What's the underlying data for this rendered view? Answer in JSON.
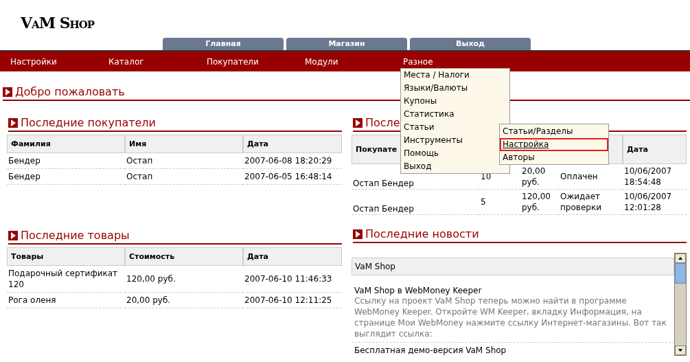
{
  "logo": "VaM Shop",
  "tabs": [
    "Главная",
    "Магазин",
    "Выход"
  ],
  "nav": [
    "Настройки",
    "Каталог",
    "Покупатели",
    "Модули",
    "Разное"
  ],
  "dropdown": {
    "items": [
      {
        "label": "Места / Налоги"
      },
      {
        "label": "Языки/Валюты"
      },
      {
        "label": "Купоны"
      },
      {
        "label": "Статистика"
      },
      {
        "label": "Статьи",
        "children": [
          {
            "label": "Статьи/Разделы",
            "selected": false
          },
          {
            "label": "Настройка",
            "selected": true
          },
          {
            "label": "Авторы",
            "selected": false
          }
        ]
      },
      {
        "label": "Инструменты"
      },
      {
        "label": "Помощь"
      },
      {
        "label": "Выход"
      }
    ]
  },
  "welcome": "Добро пожаловать",
  "customers": {
    "title": "Последние покупатели",
    "columns": [
      "Фамилия",
      "Имя",
      "Дата"
    ],
    "rows": [
      [
        "Бендер",
        "Остап",
        "2007-06-08 18:20:29"
      ],
      [
        "Бендер",
        "Остап",
        "2007-06-05 16:48:14"
      ]
    ]
  },
  "orders": {
    "title": "После",
    "columns": [
      "Покупате",
      null,
      null,
      null,
      "Дата"
    ],
    "rows": [
      [
        "Остап Бендер",
        "10",
        "20,00 руб.",
        "Оплачен",
        "10/06/2007 18:54:48"
      ],
      [
        "Остап Бендер",
        "5",
        "120,00 руб.",
        "Ожидает проверки",
        "10/06/2007 12:01:28"
      ]
    ]
  },
  "products": {
    "title": "Последние товары",
    "columns": [
      "Товары",
      "Стоимость",
      "Дата"
    ],
    "rows": [
      [
        "Подарочный сертификат 120",
        "120,00 руб.",
        "2007-06-10 11:46:33"
      ],
      [
        "Рога оленя",
        "20,00 руб.",
        "2007-06-10 12:11:25"
      ]
    ]
  },
  "news": {
    "title": "Последние новости",
    "header": "VaM Shop",
    "items": [
      {
        "title": "VaM Shop в WebMoney Keeper",
        "text": "Ссылку на проект VaM Shop теперь можно найти в программе WebMoney Keeper. Откройте WM Keeper, вкладку Информация, на странице Мои WebMoney нажмите ссылку Интернет-магазины. Вот так выглядит ссылка:"
      },
      {
        "title": "Бесплатная демо-версия VaM Shop"
      }
    ]
  }
}
